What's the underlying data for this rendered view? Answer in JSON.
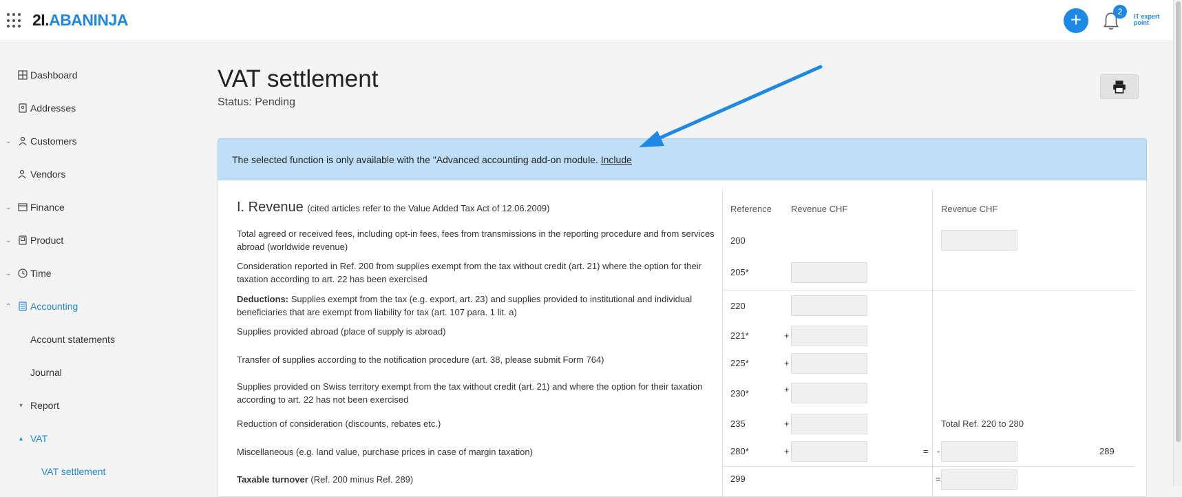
{
  "header": {
    "logo_prefix": "2I.",
    "logo_brand": "ABANINJA",
    "notification_count": "2",
    "user_logo": "IT expert point",
    "add_button": "+"
  },
  "sidebar": {
    "items": [
      {
        "label": "Dashboard",
        "icon": "dashboard-icon"
      },
      {
        "label": "Addresses",
        "icon": "addresses-icon"
      },
      {
        "label": "Customers",
        "icon": "customers-icon"
      },
      {
        "label": "Vendors",
        "icon": "vendors-icon"
      },
      {
        "label": "Finance",
        "icon": "finance-icon"
      },
      {
        "label": "Product",
        "icon": "product-icon"
      },
      {
        "label": "Time",
        "icon": "time-icon"
      },
      {
        "label": "Accounting",
        "icon": "accounting-icon"
      },
      {
        "label": "Account statements"
      },
      {
        "label": "Journal"
      },
      {
        "label": "Report"
      },
      {
        "label": "VAT"
      },
      {
        "label": "VAT settlement"
      }
    ]
  },
  "page": {
    "title": "VAT settlement",
    "status": "Status: Pending"
  },
  "banner": {
    "text": "The selected function is only available with the \"Advanced accounting add-on module. ",
    "link": "Include"
  },
  "section": {
    "title": "I. Revenue",
    "subtitle": "(cited articles refer to the Value Added Tax Act of 12.06.2009)",
    "col_reference": "Reference",
    "col_revenue_1": "Revenue CHF",
    "col_revenue_2": "Revenue CHF",
    "total_label": "Total Ref. 220 to 280",
    "total_ref": "289",
    "rows": [
      {
        "desc_bold": "",
        "desc": "Total agreed or received fees, including opt-in fees, fees from transmissions in the reporting procedure and from services abroad (worldwide revenue)",
        "ref": "200",
        "sign": ""
      },
      {
        "desc_bold": "",
        "desc": "Consideration reported in Ref. 200 from supplies exempt from the tax without credit (art. 21) where the option for their taxation according to art. 22 has been exercised",
        "ref": "205*",
        "sign": ""
      },
      {
        "desc_bold": "Deductions:",
        "desc": " Supplies exempt from the tax (e.g. export, art. 23) and supplies provided to institutional and individual beneficiaries that are exempt from liability for tax (art. 107 para. 1 lit. a)",
        "ref": "220",
        "sign": ""
      },
      {
        "desc_bold": "",
        "desc": "Supplies provided abroad (place of supply is abroad)",
        "ref": "221*",
        "sign": "+"
      },
      {
        "desc_bold": "",
        "desc": "Transfer of supplies according to the notification procedure (art. 38, please submit Form 764)",
        "ref": "225*",
        "sign": "+"
      },
      {
        "desc_bold": "",
        "desc": "Supplies provided on Swiss territory exempt from the tax without credit (art. 21) and where the option for their taxation according to art. 22 has not been exercised",
        "ref": "230*",
        "sign": "+"
      },
      {
        "desc_bold": "",
        "desc": "Reduction of consideration (discounts, rebates etc.)",
        "ref": "235",
        "sign": "+"
      },
      {
        "desc_bold": "",
        "desc": "Miscellaneous (e.g. land value, purchase prices in case of margin taxation)",
        "ref": "280*",
        "sign": "+"
      },
      {
        "desc_bold": "Taxable turnover",
        "desc": " (Ref. 200 minus Ref. 289)",
        "ref": "299",
        "sign": ""
      }
    ],
    "eq_sign": "=",
    "minus_sign": "-"
  }
}
